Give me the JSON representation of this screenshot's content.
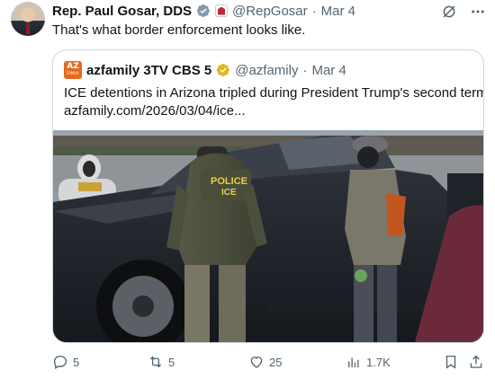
{
  "author": {
    "name": "Rep. Paul Gosar, DDS",
    "handle": "@RepGosar",
    "date": "Mar 4",
    "separator": "·"
  },
  "tweet": {
    "text": "That's what border enforcement looks like."
  },
  "quote": {
    "logo_text": "AZ",
    "logo_sub": "FAMILY",
    "name": "azfamily 3TV CBS 5",
    "handle": "@azfamily",
    "separator": "·",
    "date": "Mar 4",
    "text": "ICE detentions in Arizona tripled during President Trump's second term",
    "link": "azfamily.com/2026/03/04/ice...",
    "vest_line1": "POLICE",
    "vest_line2": "ICE"
  },
  "actions": {
    "replies": "5",
    "reposts": "5",
    "likes": "25",
    "views": "1.7K"
  },
  "colors": {
    "accent": "#1d9bf0",
    "verified_gold": "#e2b719",
    "muted": "#536471"
  },
  "icons": [
    "verified-badge-icon",
    "flag-badge-icon",
    "grok-icon",
    "more-icon",
    "reply-icon",
    "repost-icon",
    "like-icon",
    "views-icon",
    "bookmark-icon",
    "share-icon"
  ]
}
